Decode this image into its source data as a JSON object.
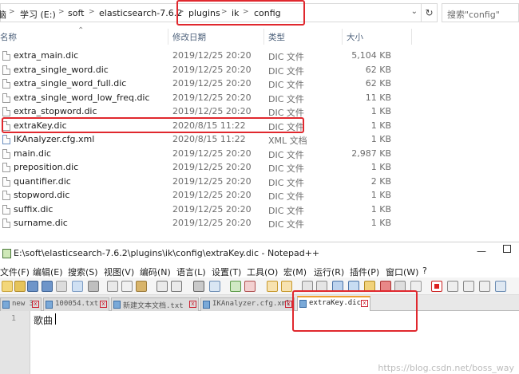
{
  "explorer": {
    "breadcrumb": [
      "脑",
      "学习 (E:)",
      "soft",
      "elasticsearch-7.6.2",
      "plugins",
      "ik",
      "config"
    ],
    "search_placeholder": "搜索\"config\"",
    "columns": {
      "name": "名称",
      "date": "修改日期",
      "type": "类型",
      "size": "大小"
    },
    "files": [
      {
        "name": "extra_main.dic",
        "date": "2019/12/25 20:20",
        "type": "DIC 文件",
        "size": "5,104 KB",
        "icon": "file-icon"
      },
      {
        "name": "extra_single_word.dic",
        "date": "2019/12/25 20:20",
        "type": "DIC 文件",
        "size": "62 KB",
        "icon": "file-icon"
      },
      {
        "name": "extra_single_word_full.dic",
        "date": "2019/12/25 20:20",
        "type": "DIC 文件",
        "size": "62 KB",
        "icon": "file-icon"
      },
      {
        "name": "extra_single_word_low_freq.dic",
        "date": "2019/12/25 20:20",
        "type": "DIC 文件",
        "size": "11 KB",
        "icon": "file-icon"
      },
      {
        "name": "extra_stopword.dic",
        "date": "2019/12/25 20:20",
        "type": "DIC 文件",
        "size": "1 KB",
        "icon": "file-icon"
      },
      {
        "name": "extraKey.dic",
        "date": "2020/8/15 11:22",
        "type": "DIC 文件",
        "size": "1 KB",
        "icon": "file-icon"
      },
      {
        "name": "IKAnalyzer.cfg.xml",
        "date": "2020/8/15 11:22",
        "type": "XML 文档",
        "size": "1 KB",
        "icon": "xml-file-icon"
      },
      {
        "name": "main.dic",
        "date": "2019/12/25 20:20",
        "type": "DIC 文件",
        "size": "2,987 KB",
        "icon": "file-icon"
      },
      {
        "name": "preposition.dic",
        "date": "2019/12/25 20:20",
        "type": "DIC 文件",
        "size": "1 KB",
        "icon": "file-icon"
      },
      {
        "name": "quantifier.dic",
        "date": "2019/12/25 20:20",
        "type": "DIC 文件",
        "size": "2 KB",
        "icon": "file-icon"
      },
      {
        "name": "stopword.dic",
        "date": "2019/12/25 20:20",
        "type": "DIC 文件",
        "size": "1 KB",
        "icon": "file-icon"
      },
      {
        "name": "suffix.dic",
        "date": "2019/12/25 20:20",
        "type": "DIC 文件",
        "size": "1 KB",
        "icon": "file-icon"
      },
      {
        "name": "surname.dic",
        "date": "2019/12/25 20:20",
        "type": "DIC 文件",
        "size": "1 KB",
        "icon": "file-icon"
      }
    ],
    "highlight_color": "#e0282e"
  },
  "notepad": {
    "title": "E:\\soft\\elasticsearch-7.6.2\\plugins\\ik\\config\\extraKey.dic - Notepad++",
    "menus": [
      "文件(F)",
      "编辑(E)",
      "搜索(S)",
      "视图(V)",
      "编码(N)",
      "语言(L)",
      "设置(T)",
      "工具(O)",
      "宏(M)",
      "运行(R)",
      "插件(P)",
      "窗口(W)",
      "?"
    ],
    "tabs": [
      "new 3",
      "100054.txt",
      "新建文本文档.txt",
      "IKAnalyzer.cfg.xml",
      "extraKey.dic"
    ],
    "active_tab": "extraKey.dic",
    "line_number": "1",
    "line_text": "歌曲",
    "watermark": "https://blog.csdn.net/boss_way"
  }
}
